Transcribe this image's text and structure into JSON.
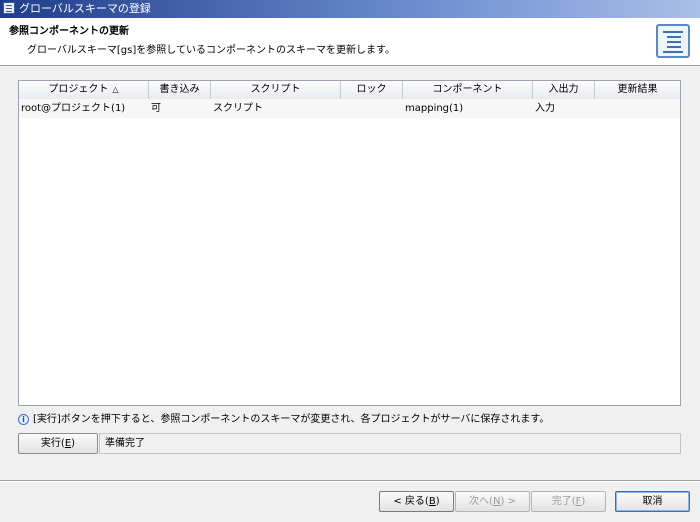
{
  "window": {
    "title": "グローバルスキーマの登録"
  },
  "banner": {
    "heading": "参照コンポーネントの更新",
    "description": "グローバルスキーマ[gs]を参照しているコンポーネントのスキーマを更新します。"
  },
  "table": {
    "columns": [
      "プロジェクト",
      "書き込み",
      "スクリプト",
      "ロック",
      "コンポーネント",
      "入出力",
      "更新結果"
    ],
    "sort_indicator": "△",
    "rows": [
      [
        "root@プロジェクト(1)",
        "可",
        "スクリプト",
        "",
        "mapping(1)",
        "入力",
        ""
      ]
    ]
  },
  "info": {
    "message": "[実行]ボタンを押下すると、参照コンポーネントのスキーマが変更され、各プロジェクトがサーバに保存されます。"
  },
  "execute": {
    "label": "実行(",
    "mnemonic": "E",
    "suffix": ")"
  },
  "status": {
    "text": "準備完了"
  },
  "buttons": {
    "back": {
      "label": "< 戻る(",
      "mnemonic": "B",
      "suffix": ")"
    },
    "next": {
      "label": "次へ(",
      "mnemonic": "N",
      "suffix": ") >"
    },
    "finish": {
      "label": "完了(",
      "mnemonic": "F",
      "suffix": ")"
    },
    "cancel": {
      "label": "取消"
    }
  }
}
